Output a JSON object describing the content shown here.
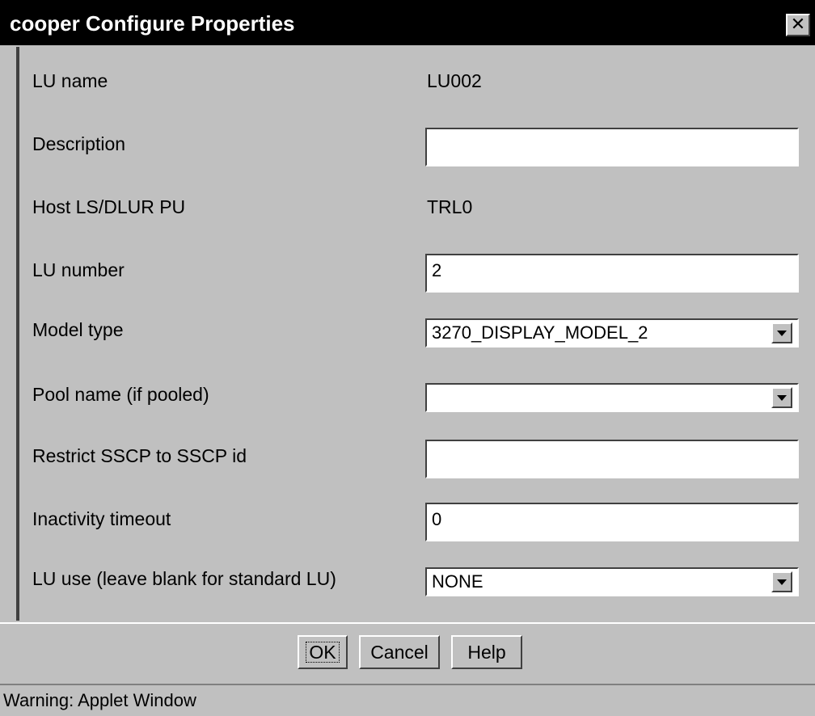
{
  "window": {
    "title": "cooper  Configure Properties",
    "close_label": "✕"
  },
  "fields": {
    "lu_name": {
      "label": "LU name",
      "value": "LU002"
    },
    "description": {
      "label": "Description",
      "value": ""
    },
    "host": {
      "label": "Host LS/DLUR PU",
      "value": "TRL0"
    },
    "lu_number": {
      "label": "LU number",
      "value": "2"
    },
    "model_type": {
      "label": "Model type",
      "value": "3270_DISPLAY_MODEL_2"
    },
    "pool_name": {
      "label": "Pool name (if pooled)",
      "value": ""
    },
    "restrict_sscp": {
      "label": "Restrict SSCP to SSCP id",
      "value": ""
    },
    "inactivity": {
      "label": "Inactivity timeout",
      "value": "0"
    },
    "lu_use": {
      "label": "LU use (leave blank for standard LU)",
      "value": "NONE"
    }
  },
  "buttons": {
    "ok": "OK",
    "cancel": "Cancel",
    "help": "Help"
  },
  "status": {
    "text": "Warning: Applet Window"
  }
}
